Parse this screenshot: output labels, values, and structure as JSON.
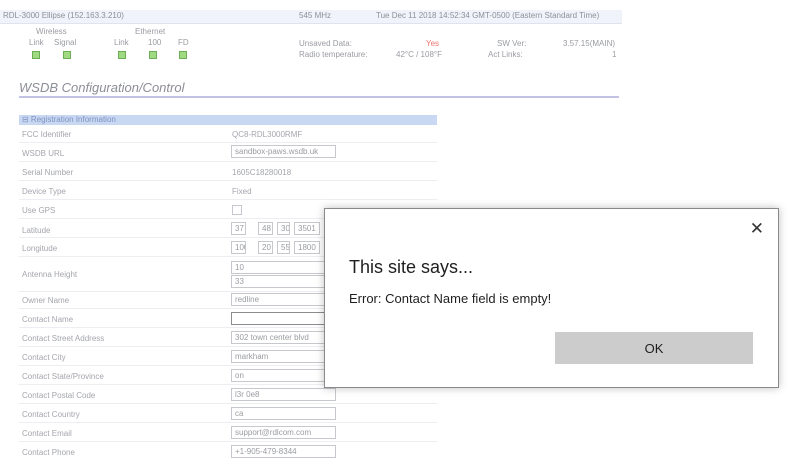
{
  "status_bar": {
    "device": "RDL-3000 Ellipse (152.163.3.210)",
    "frequency": "545 MHz",
    "datetime": "Tue Dec 11 2018 14:52:34 GMT-0500 (Eastern Standard Time)"
  },
  "indicators": {
    "wireless_label": "Wireless",
    "ethernet_label": "Ethernet",
    "link": "Link",
    "signal": "Signal",
    "link2": "Link",
    "speed": "100",
    "fd": "FD",
    "led_color": "#9fda82"
  },
  "stats": {
    "unsaved_label": "Unsaved Data:",
    "unsaved_value": "Yes",
    "radio_temp_label": "Radio temperature:",
    "radio_temp_value": "42°C / 108°F",
    "sw_label": "SW Ver:",
    "sw_value": "3.57.15(MAIN)",
    "act_label": "Act Links:",
    "act_value": "1"
  },
  "page": {
    "title": "WSDB Configuration/Control",
    "section": "⊟ Registration Information"
  },
  "form": {
    "fcc_label": "FCC Identifier",
    "fcc_value": "QC8-RDL3000RMF",
    "wsdb_url_label": "WSDB URL",
    "wsdb_url_value": "sandbox-paws.wsdb.uk",
    "serial_label": "Serial Number",
    "serial_value": "1605C18280018",
    "device_type_label": "Device Type",
    "device_type_value": "Fixed",
    "use_gps_label": "Use GPS",
    "latitude_label": "Latitude",
    "lat_deg": "37",
    "lat_min": "48",
    "lat_sec": "30",
    "lat_frac": "3501",
    "longitude_label": "Longitude",
    "lon_deg": "100",
    "lon_min": "20",
    "lon_sec": "55",
    "lon_frac": "1800",
    "antenna_label": "Antenna Height",
    "antenna_value1": "10",
    "antenna_value2": "33",
    "owner_label": "Owner Name",
    "owner_value": "redline",
    "contact_name_label": "Contact Name",
    "contact_name_value": "",
    "street_label": "Contact Street Address",
    "street_value": "302 town center blvd",
    "city_label": "Contact City",
    "city_value": "markham",
    "state_label": "Contact State/Province",
    "state_value": "on",
    "postal_label": "Contact Postal Code",
    "postal_value": "l3r 0e8",
    "country_label": "Contact Country",
    "country_value": "ca",
    "email_label": "Contact Email",
    "email_value": "support@rdlcom.com",
    "phone_label": "Contact Phone",
    "phone_value": "+1-905-479-8344"
  },
  "dialog": {
    "title": "This site says...",
    "message": "Error: Contact Name field is empty!",
    "ok_label": "OK",
    "close_glyph": "✕"
  }
}
